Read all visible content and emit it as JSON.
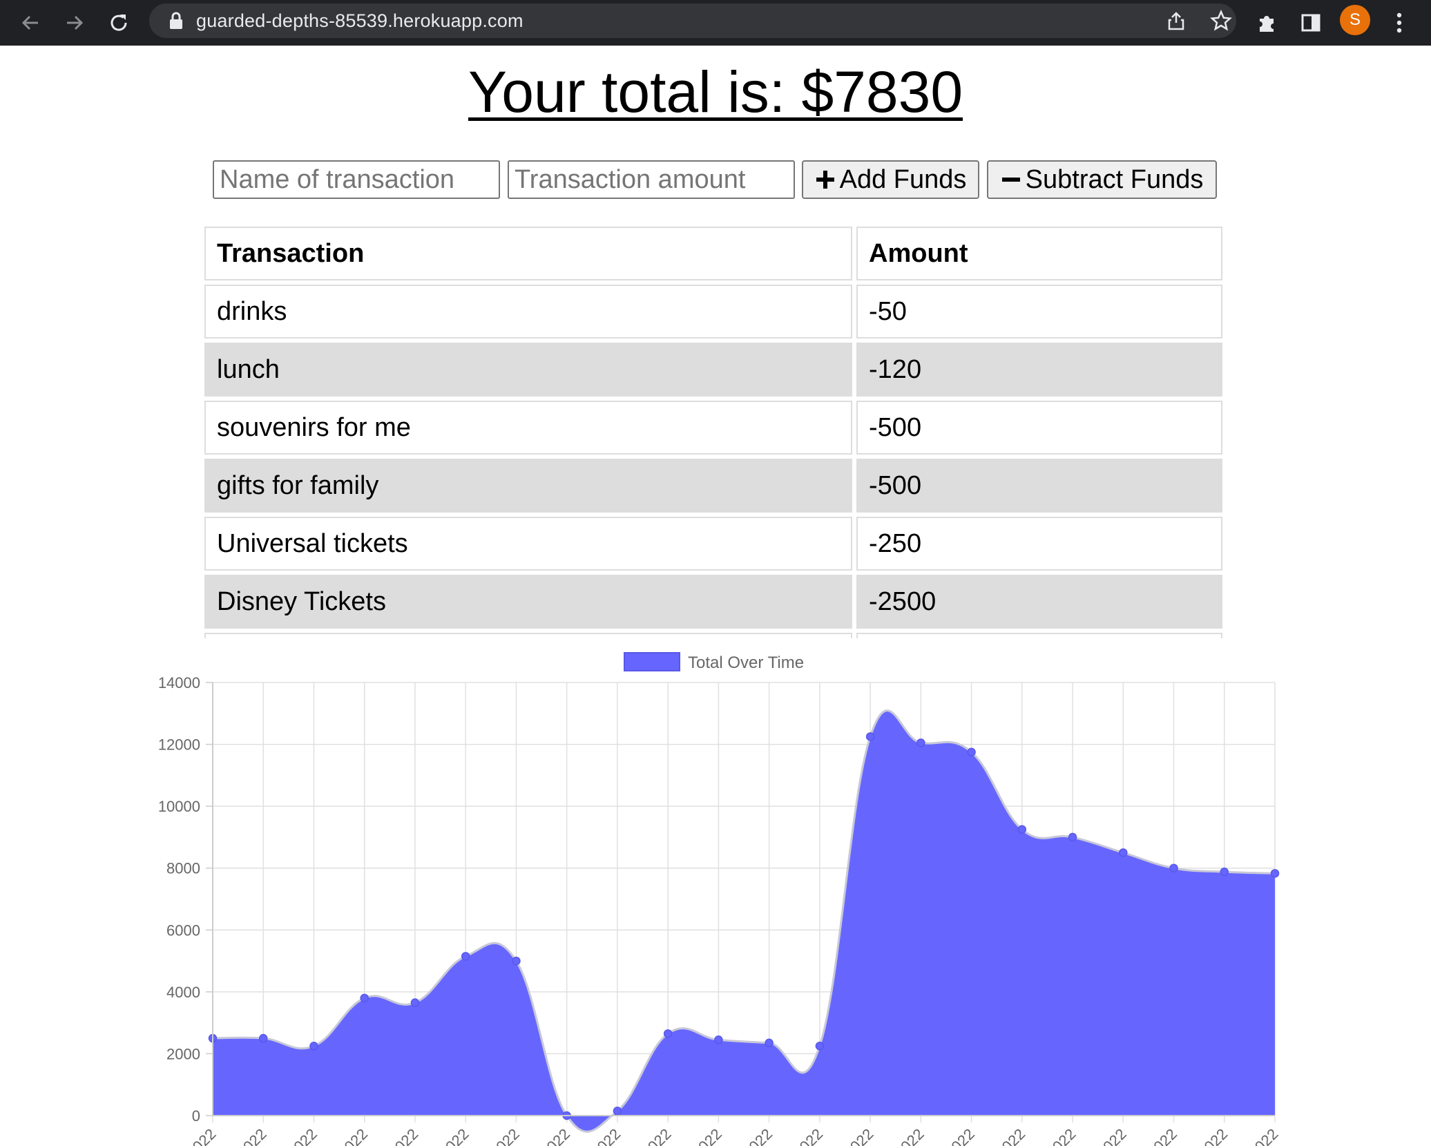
{
  "browser": {
    "url": "guarded-depths-85539.herokuapp.com",
    "avatar_letter": "S"
  },
  "page": {
    "title": "Your total is: $7830",
    "name_placeholder": "Name of transaction",
    "amount_placeholder": "Transaction amount",
    "add_label": "Add Funds",
    "subtract_label": "Subtract Funds"
  },
  "table": {
    "headers": [
      "Transaction",
      "Amount"
    ],
    "rows": [
      {
        "name": "drinks",
        "amount": "-50"
      },
      {
        "name": "lunch",
        "amount": "-120"
      },
      {
        "name": "souvenirs for me",
        "amount": "-500"
      },
      {
        "name": "gifts for family",
        "amount": "-500"
      },
      {
        "name": "Universal tickets",
        "amount": "-250"
      },
      {
        "name": "Disney Tickets",
        "amount": "-2500"
      }
    ]
  },
  "chart_data": {
    "type": "area",
    "legend": "Total Over Time",
    "legend_position": "top",
    "color": "#6666ff",
    "ylim": [
      0,
      14000
    ],
    "yticks": [
      0,
      2000,
      4000,
      6000,
      8000,
      10000,
      12000,
      14000
    ],
    "x_tick_label": "022",
    "grid": true,
    "values": [
      2500,
      2500,
      2250,
      3800,
      3650,
      5150,
      5000,
      0,
      150,
      2650,
      2450,
      2350,
      2250,
      12250,
      12050,
      11750,
      9250,
      9000,
      8500,
      8000,
      7880,
      7830
    ]
  }
}
